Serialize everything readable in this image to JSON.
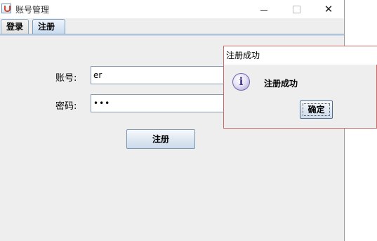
{
  "window": {
    "title": "账号管理",
    "controls": {
      "minimize": "—",
      "maximize": "□",
      "close": "✕"
    }
  },
  "tabs": [
    {
      "label": "登录"
    },
    {
      "label": "注册",
      "selected": true
    }
  ],
  "form": {
    "account_label": "账号:",
    "account_value": "er",
    "password_label": "密码:",
    "password_value": "•••",
    "register_button": "注册"
  },
  "dialog": {
    "title": "注册成功",
    "icon": "info-icon",
    "icon_glyph": "i",
    "message": "注册成功",
    "ok_button": "确定"
  },
  "colors": {
    "window_bg": "#eeeeee",
    "tab_selected": "#c9dcf0",
    "dialog_border": "#c96b6b",
    "info_icon": "#a79fd6"
  }
}
